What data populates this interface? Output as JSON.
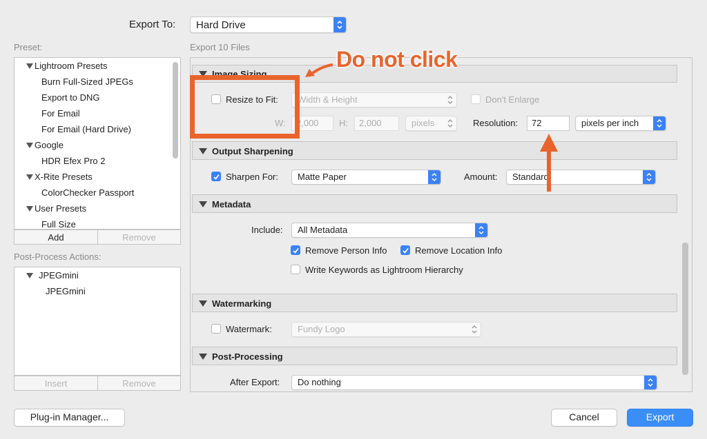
{
  "export_to": {
    "label": "Export To:",
    "value": "Hard Drive"
  },
  "preset": {
    "header": "Preset:",
    "items": [
      {
        "label": "Lightroom Presets",
        "group": true
      },
      {
        "label": "Burn Full-Sized JPEGs"
      },
      {
        "label": "Export to DNG"
      },
      {
        "label": "For Email"
      },
      {
        "label": "For Email (Hard Drive)"
      },
      {
        "label": "Google",
        "group": true
      },
      {
        "label": "HDR Efex Pro 2"
      },
      {
        "label": "X-Rite Presets",
        "group": true
      },
      {
        "label": "ColorChecker Passport"
      },
      {
        "label": "User Presets",
        "group": true
      },
      {
        "label": "Full Size"
      }
    ],
    "add": "Add",
    "remove": "Remove"
  },
  "post_process_actions": {
    "header": "Post-Process Actions:",
    "items": [
      {
        "label": "JPEGmini",
        "group": true
      },
      {
        "label": "JPEGmini"
      }
    ],
    "insert": "Insert",
    "remove": "Remove"
  },
  "export_files_label": "Export 10 Files",
  "image_sizing": {
    "title": "Image Sizing",
    "resize_label": "Resize to Fit:",
    "resize_checked": false,
    "resize_mode": "Width & Height",
    "dont_enlarge": "Don't Enlarge",
    "w_label": "W:",
    "w_value": "2,000",
    "h_label": "H:",
    "h_value": "2,000",
    "units": "pixels",
    "resolution_label": "Resolution:",
    "resolution_value": "72",
    "resolution_units": "pixels per inch"
  },
  "output_sharpening": {
    "title": "Output Sharpening",
    "sharpen_label": "Sharpen For:",
    "sharpen_checked": true,
    "sharpen_value": "Matte Paper",
    "amount_label": "Amount:",
    "amount_value": "Standard"
  },
  "metadata": {
    "title": "Metadata",
    "include_label": "Include:",
    "include_value": "All Metadata",
    "remove_person": "Remove Person Info",
    "remove_location": "Remove Location Info",
    "write_keywords": "Write Keywords as Lightroom Hierarchy"
  },
  "watermarking": {
    "title": "Watermarking",
    "watermark_label": "Watermark:",
    "watermark_value": "Fundy Logo"
  },
  "post_processing": {
    "title": "Post-Processing",
    "after_export_label": "After Export:",
    "after_export_value": "Do nothing"
  },
  "buttons": {
    "plugin_manager": "Plug-in Manager...",
    "cancel": "Cancel",
    "export": "Export"
  },
  "annotation": {
    "text": "Do not click",
    "color": "#e8642c"
  }
}
